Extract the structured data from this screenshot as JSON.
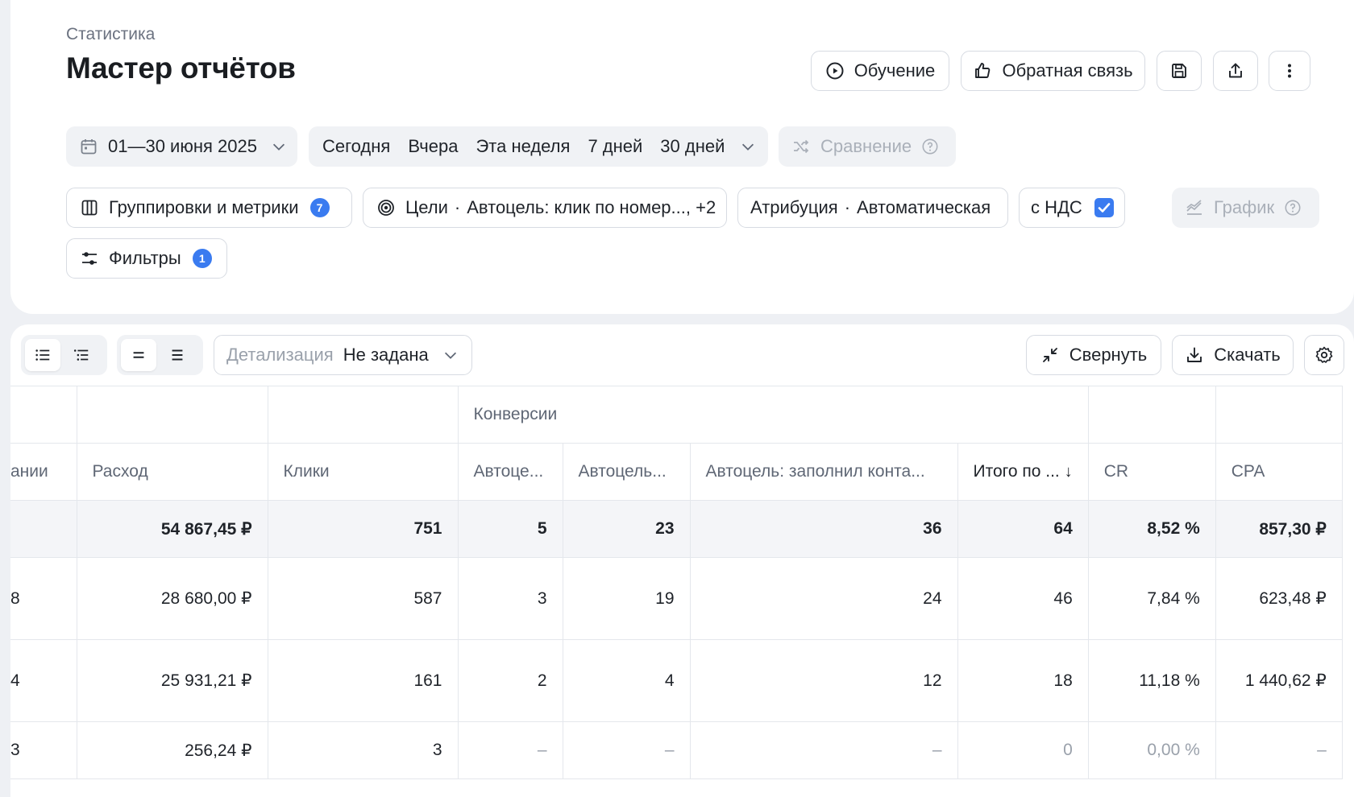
{
  "header": {
    "breadcrumb": "Статистика",
    "title": "Мастер отчётов",
    "buttons": {
      "training": "Обучение",
      "feedback": "Обратная связь"
    }
  },
  "filters": {
    "date_range": "01—30 июня 2025",
    "presets": [
      "Сегодня",
      "Вчера",
      "Эта неделя",
      "7 дней",
      "30 дней"
    ],
    "comparison": "Сравнение",
    "grouping_label": "Группировки и метрики",
    "grouping_count": "7",
    "goals_label": "Цели",
    "goals_value": "Автоцель: клик по номер..., +2",
    "attribution_label": "Атрибуция",
    "attribution_value": "Автоматическая",
    "vat_label": "с НДС",
    "vat_checked": true,
    "chart_label": "График",
    "filters_label": "Фильтры",
    "filters_count": "1"
  },
  "toolbar": {
    "detail_label": "Детализация",
    "detail_value": "Не задана",
    "collapse": "Свернуть",
    "download": "Скачать"
  },
  "table": {
    "group_header": "Конверсии",
    "columns": [
      "ании",
      "Расход",
      "Клики",
      "Автоце...",
      "Автоцель...",
      "Автоцель: заполнил конта...",
      "Итого по ...",
      "CR",
      "CPA"
    ],
    "total": [
      "",
      "54 867,45 ₽",
      "751",
      "5",
      "23",
      "36",
      "64",
      "8,52 %",
      "857,30 ₽"
    ],
    "rows": [
      [
        "8",
        "28 680,00 ₽",
        "587",
        "3",
        "19",
        "24",
        "46",
        "7,84 %",
        "623,48 ₽"
      ],
      [
        "4",
        "25 931,21 ₽",
        "161",
        "2",
        "4",
        "12",
        "18",
        "11,18 %",
        "1 440,62 ₽"
      ],
      [
        "3",
        "256,24 ₽",
        "3",
        "–",
        "–",
        "–",
        "0",
        "0,00 %",
        "–"
      ]
    ]
  },
  "colors": {
    "accent": "#3a7bf0",
    "text": "#1f2329",
    "muted": "#9aa1ab"
  }
}
